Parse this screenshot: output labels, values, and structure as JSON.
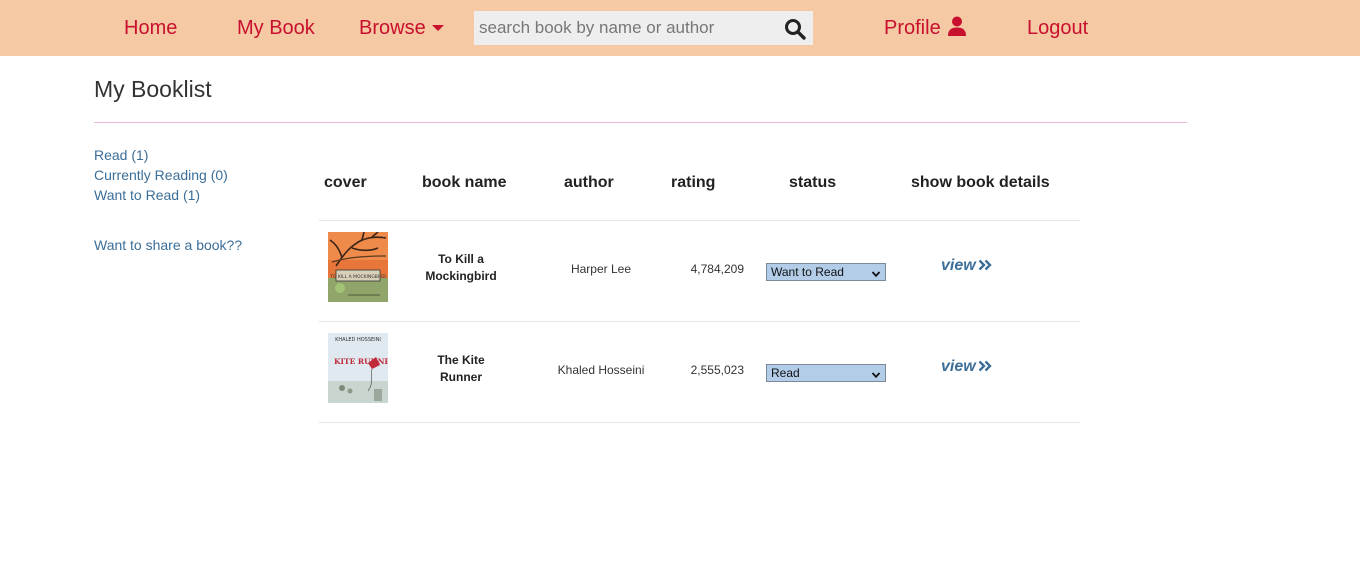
{
  "nav": {
    "home": "Home",
    "my_book": "My Book",
    "browse": "Browse",
    "profile": "Profile",
    "logout": "Logout"
  },
  "search": {
    "placeholder": "search book by name or author",
    "value": ""
  },
  "page": {
    "title": "My Booklist"
  },
  "sidebar": {
    "shelves": [
      {
        "label": "Read (1)"
      },
      {
        "label": "Currently Reading (0)"
      },
      {
        "label": "Want to Read (1)"
      }
    ],
    "share_label": "Want to share a book??"
  },
  "table": {
    "headers": {
      "cover": "cover",
      "name": "book name",
      "author": "author",
      "rating": "rating",
      "status": "status",
      "details": "show book details"
    },
    "rows": [
      {
        "name_line1": "To Kill a",
        "name_line2": "Mockingbird",
        "author": "Harper Lee",
        "rating": "4,784,209",
        "status": "Want to Read",
        "view": "view",
        "cover_text": "TO KILL A MOCKINGBIRD"
      },
      {
        "name_line1": "The Kite",
        "name_line2": "Runner",
        "author": "Khaled Hosseini",
        "rating": "2,555,023",
        "status": "Read",
        "view": "view",
        "cover_text": "KITE RUNNER"
      }
    ]
  },
  "colors": {
    "navbar_bg": "#f5c9a4",
    "nav_text": "#c8102e",
    "link": "#3b6e98",
    "select_bg": "#b3cde9"
  },
  "icons": {
    "browse": "caret-down-icon",
    "search": "search-icon",
    "profile": "user-icon",
    "view": "double-chevron-right-icon",
    "select": "chevron-down-icon"
  }
}
